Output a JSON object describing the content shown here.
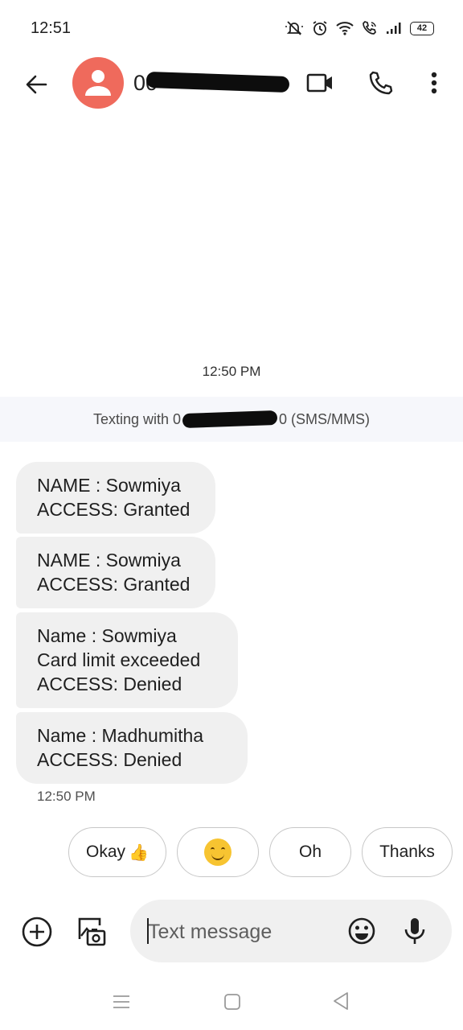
{
  "status_bar": {
    "time": "12:51",
    "battery": "42",
    "icons": [
      "mute-icon",
      "alarm-icon",
      "wifi-icon",
      "wifi-call-icon",
      "signal-icon",
      "battery-icon"
    ]
  },
  "app_bar": {
    "contact_name": "00",
    "contact_name_redacted": true,
    "icons": [
      "back-arrow-icon",
      "person-icon",
      "video-call-icon",
      "phone-icon",
      "more-vert-icon"
    ]
  },
  "conversation": {
    "timestamp_top": "12:50 PM",
    "banner": {
      "prefix": "Texting with 0",
      "suffix": "0 (SMS/MMS)",
      "number_redacted": true
    },
    "messages": [
      {
        "lines": [
          "NAME : Sowmiya",
          "ACCESS: Granted"
        ]
      },
      {
        "lines": [
          "NAME : Sowmiya",
          "ACCESS: Granted"
        ]
      },
      {
        "lines": [
          "Name : Sowmiya",
          "Card limit exceeded",
          "ACCESS: Denied"
        ]
      },
      {
        "lines": [
          "Name : Madhumitha",
          "ACCESS: Denied"
        ]
      }
    ],
    "timestamp_bottom": "12:50 PM"
  },
  "smart_replies": {
    "chip1": "Okay",
    "chip1_emoji": "thumbs-up-icon",
    "chip2_emoji": "smiling-face-icon",
    "chip3": "Oh",
    "chip4": "Thanks"
  },
  "compose": {
    "placeholder": "Text message",
    "icons": [
      "add-circle-icon",
      "gallery-camera-icon",
      "emoji-icon",
      "mic-icon"
    ]
  },
  "nav_bar": {
    "icons": [
      "recents-icon",
      "home-icon",
      "back-icon"
    ]
  },
  "colors": {
    "avatar": "#ef6a5c",
    "bubble": "#f0f0f0",
    "banner": "#f6f7fb",
    "compose": "#f0f0f0"
  }
}
